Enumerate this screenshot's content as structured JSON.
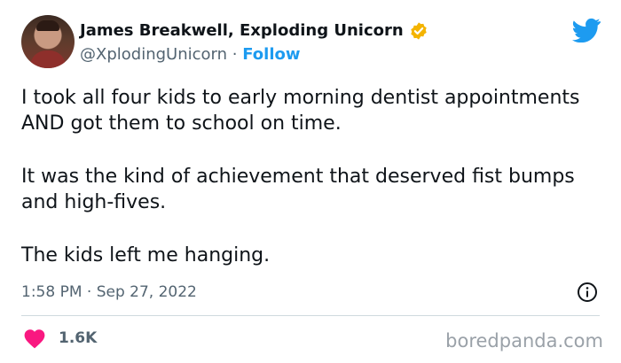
{
  "author": {
    "display_name": "James Breakwell, Exploding Unicorn",
    "handle": "@XplodingUnicorn",
    "separator": "·",
    "follow_label": "Follow",
    "verified_icon": "verified-badge-icon",
    "verified_color": "#f4b400"
  },
  "tweet": {
    "paragraphs": [
      "I took all four kids to early morning dentist appointments AND got them to school on time.",
      "It was the kind of achievement that deserved fist bumps and high-fives.",
      "The kids left me hanging."
    ],
    "timestamp": "1:58 PM · Sep 27, 2022"
  },
  "engagement": {
    "likes": "1.6K",
    "heart_color": "#f91880"
  },
  "brand": {
    "twitter_color": "#1d9bf0",
    "watermark": "boredpanda.com"
  }
}
